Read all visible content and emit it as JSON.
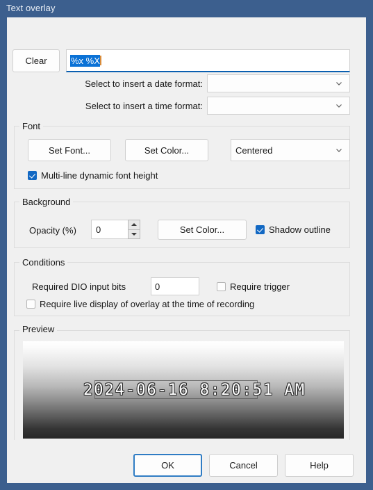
{
  "window": {
    "title": "Text overlay",
    "frame_color": "#3c5f8e",
    "dialog_bg": "#f0f0f0"
  },
  "format_row": {
    "clear_label": "Clear",
    "format_value": "%x %X",
    "format_selected": true,
    "date_format_label": "Select to insert a date format:",
    "date_format_value": "",
    "time_format_label": "Select to insert a time format:",
    "time_format_value": ""
  },
  "font_group": {
    "title": "Font",
    "set_font_label": "Set Font...",
    "set_color_label": "Set Color...",
    "alignment_value": "Centered",
    "multiline_label": "Multi-line dynamic font height",
    "multiline_checked": true
  },
  "background_group": {
    "title": "Background",
    "opacity_label": "Opacity (%)",
    "opacity_value": "0",
    "set_color_label": "Set Color...",
    "shadow_label": "Shadow outline",
    "shadow_checked": true
  },
  "conditions_group": {
    "title": "Conditions",
    "dio_label": "Required DIO input bits",
    "dio_value": "0",
    "require_trigger_label": "Require trigger",
    "require_trigger_checked": false,
    "require_live_label": "Require live display of overlay at the time of recording",
    "require_live_checked": false
  },
  "preview_group": {
    "title": "Preview",
    "overlay_text": "2024-06-16 8:20:51 AM"
  },
  "buttons": {
    "ok_label": "OK",
    "cancel_label": "Cancel",
    "help_label": "Help"
  },
  "colors": {
    "title_bar": "#3c5f8e",
    "selection": "#0b72d6",
    "accent": "#2f7cc4",
    "checkbox_checked": "#1268c3",
    "caret": "#d98c3a"
  }
}
